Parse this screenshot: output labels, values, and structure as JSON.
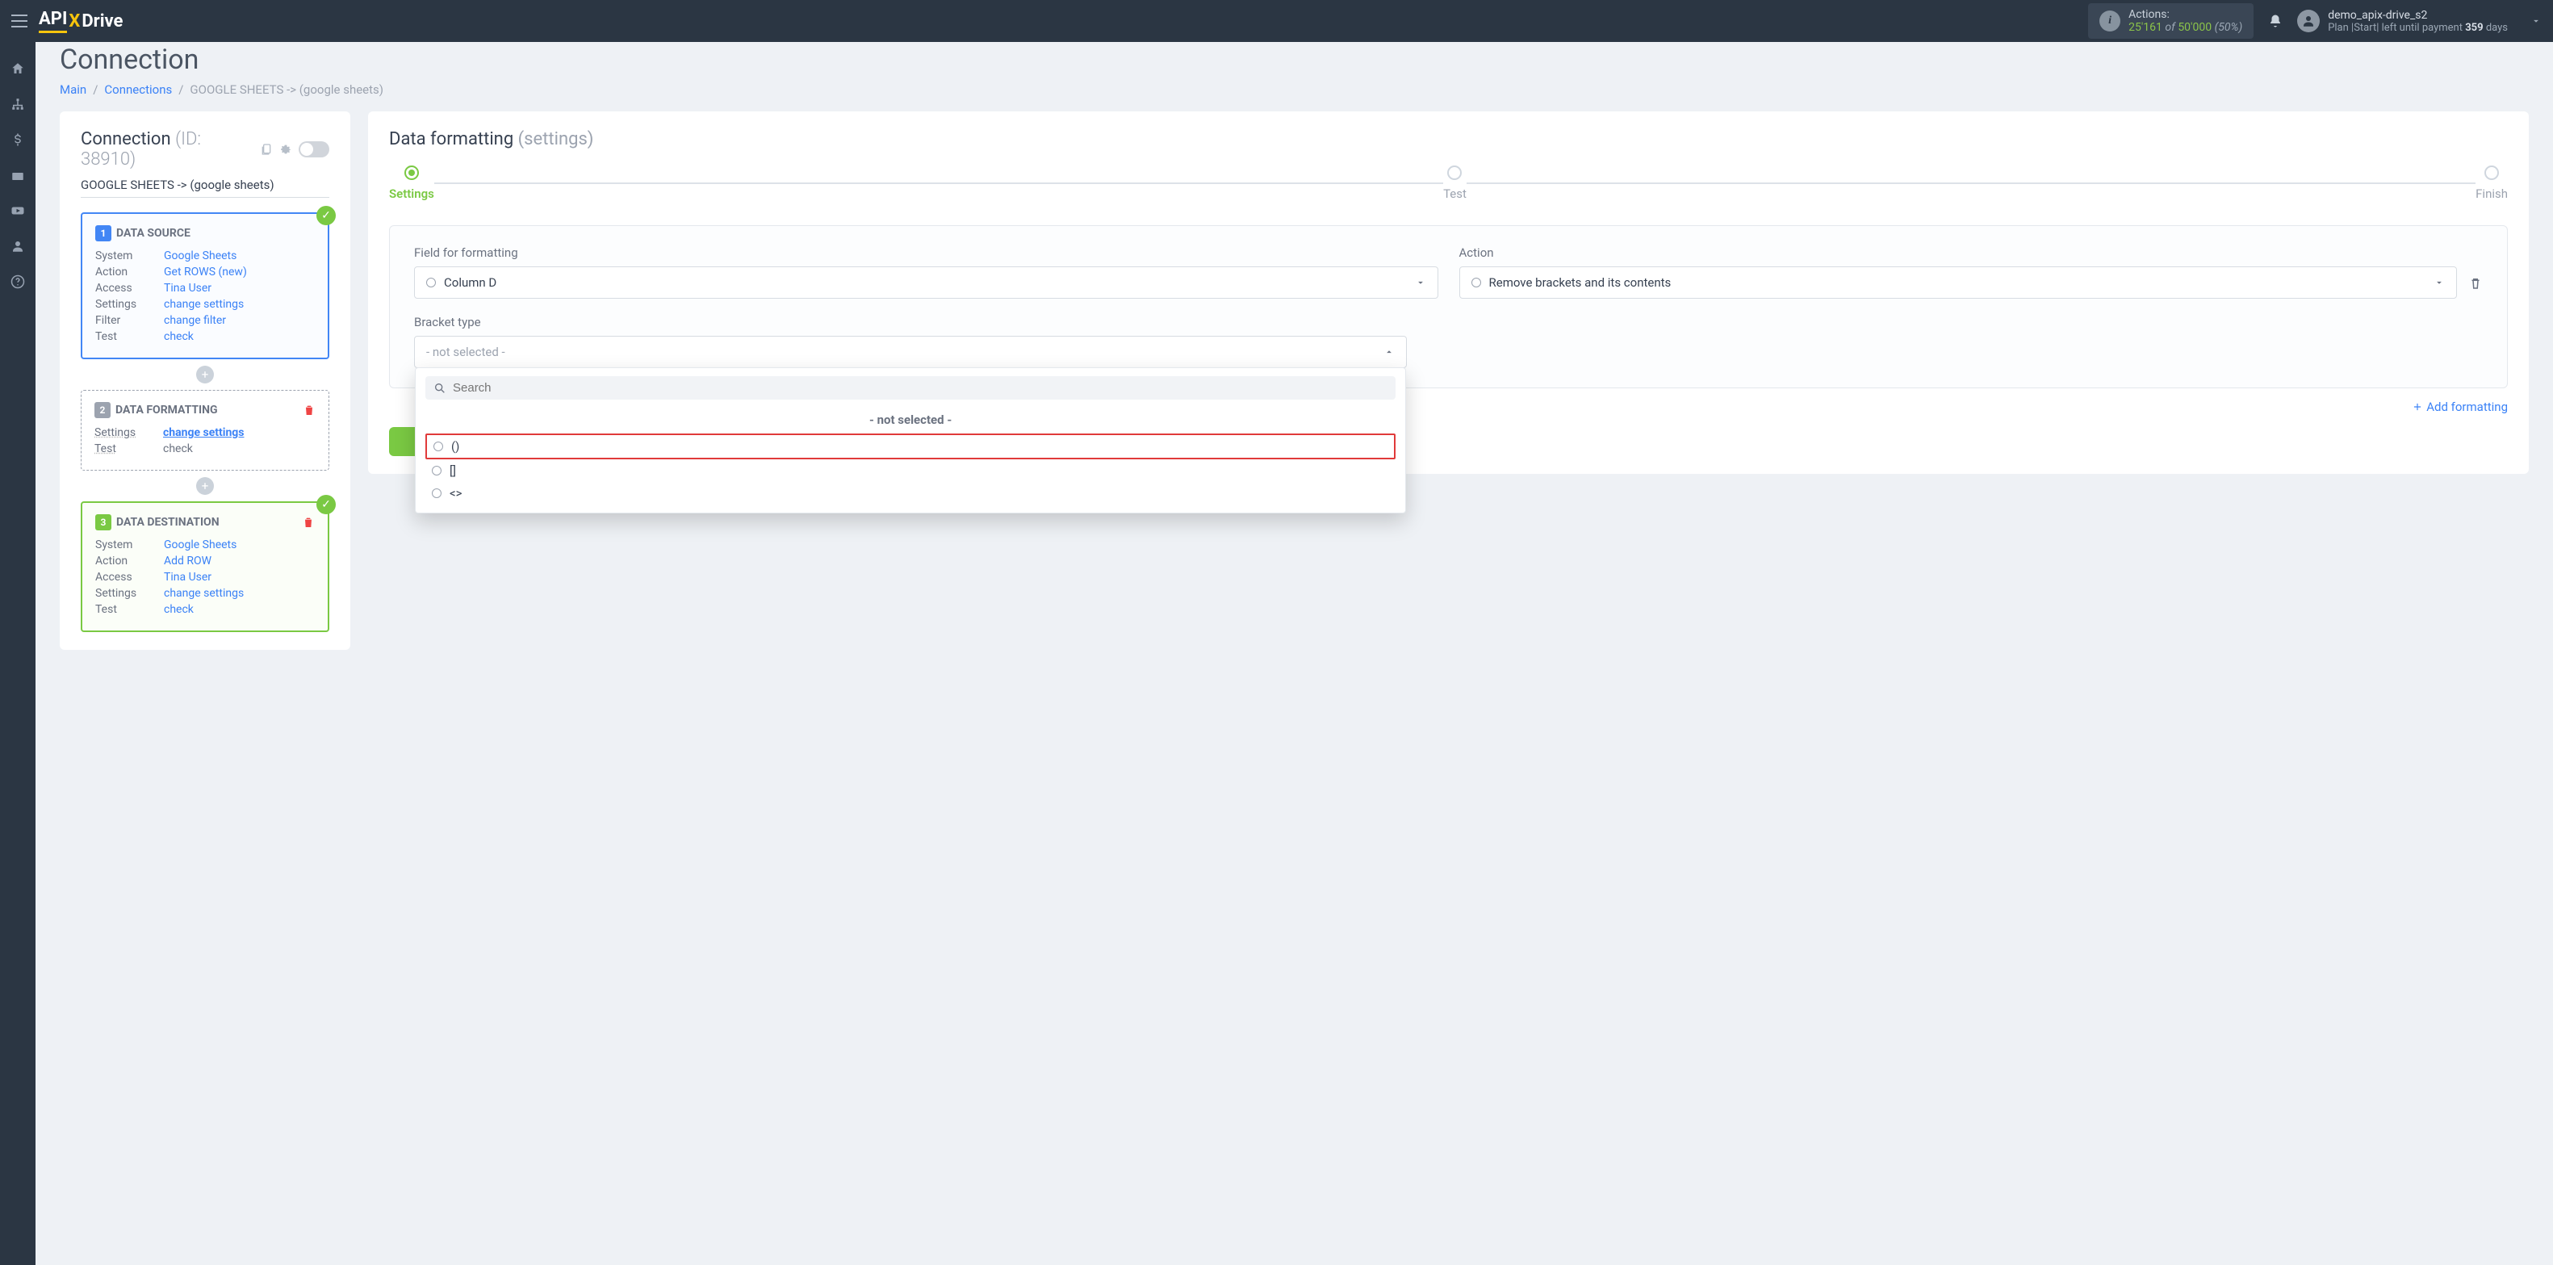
{
  "topbar": {
    "logo_api": "API",
    "logo_x": "X",
    "logo_drive": "Drive",
    "actions_label": "Actions:",
    "actions_count": "25'161",
    "actions_of": "of",
    "actions_total": "50'000",
    "actions_pct": "(50%)",
    "username": "demo_apix-drive_s2",
    "plan_prefix": "Plan |Start| left until payment ",
    "plan_days": "359",
    "plan_suffix": " days"
  },
  "page": {
    "title": "Connection",
    "bc_main": "Main",
    "bc_connections": "Connections",
    "bc_current": "GOOGLE SHEETS -> (google sheets)"
  },
  "conn": {
    "heading": "Connection",
    "id_txt": "(ID: 38910)",
    "name": "GOOGLE SHEETS -> (google sheets)",
    "step1": {
      "num": "1",
      "title": "DATA SOURCE",
      "rows": [
        {
          "lbl": "System",
          "val": "Google Sheets"
        },
        {
          "lbl": "Action",
          "val": "Get ROWS (new)"
        },
        {
          "lbl": "Access",
          "val": "Tina User"
        },
        {
          "lbl": "Settings",
          "val": "change settings"
        },
        {
          "lbl": "Filter",
          "val": "change filter"
        },
        {
          "lbl": "Test",
          "val": "check"
        }
      ]
    },
    "step2": {
      "num": "2",
      "title": "DATA FORMATTING",
      "rows": [
        {
          "lbl": "Settings",
          "val": "change settings"
        },
        {
          "lbl": "Test",
          "val": "check"
        }
      ]
    },
    "step3": {
      "num": "3",
      "title": "DATA DESTINATION",
      "rows": [
        {
          "lbl": "System",
          "val": "Google Sheets"
        },
        {
          "lbl": "Action",
          "val": "Add ROW"
        },
        {
          "lbl": "Access",
          "val": "Tina User"
        },
        {
          "lbl": "Settings",
          "val": "change settings"
        },
        {
          "lbl": "Test",
          "val": "check"
        }
      ]
    }
  },
  "right": {
    "heading": "Data formatting",
    "sub": "(settings)",
    "stepper": [
      "Settings",
      "Test",
      "Finish"
    ],
    "field_label": "Field for formatting",
    "field_value": "Column D",
    "action_label": "Action",
    "action_value": "Remove brackets and its contents",
    "bracket_label": "Bracket type",
    "bracket_value": "- not selected -",
    "search_ph": "Search",
    "dd_ns": "- not selected -",
    "dd_opts": [
      "()",
      "[]",
      "<>"
    ],
    "add_format": "Add formatting"
  }
}
